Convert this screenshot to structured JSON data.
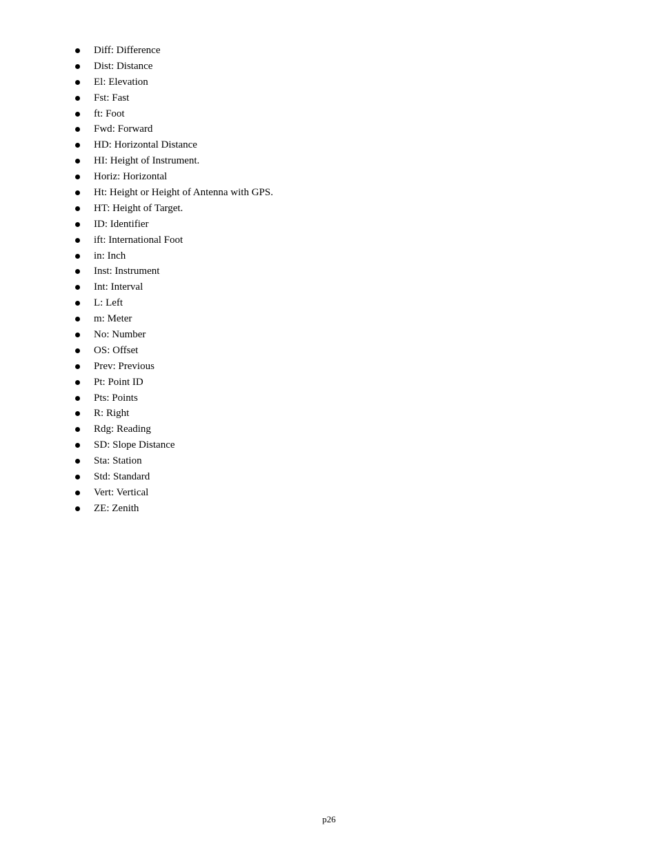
{
  "document": {
    "abbreviations": [
      {
        "abbr": "Diff",
        "meaning": "Difference"
      },
      {
        "abbr": "Dist",
        "meaning": "Distance"
      },
      {
        "abbr": "El",
        "meaning": "Elevation"
      },
      {
        "abbr": "Fst",
        "meaning": "Fast"
      },
      {
        "abbr": "ft",
        "meaning": "Foot"
      },
      {
        "abbr": "Fwd",
        "meaning": "Forward"
      },
      {
        "abbr": "HD",
        "meaning": "Horizontal Distance"
      },
      {
        "abbr": "HI",
        "meaning": "Height of Instrument."
      },
      {
        "abbr": "Horiz",
        "meaning": "Horizontal"
      },
      {
        "abbr": "Ht",
        "meaning": "Height or Height of Antenna with GPS."
      },
      {
        "abbr": "HT",
        "meaning": "Height of Target."
      },
      {
        "abbr": "ID",
        "meaning": "Identifier"
      },
      {
        "abbr": "ift",
        "meaning": "International Foot"
      },
      {
        "abbr": "in",
        "meaning": "Inch"
      },
      {
        "abbr": "Inst",
        "meaning": "Instrument"
      },
      {
        "abbr": "Int",
        "meaning": "Interval"
      },
      {
        "abbr": "L",
        "meaning": "Left"
      },
      {
        "abbr": "m",
        "meaning": "Meter"
      },
      {
        "abbr": "No",
        "meaning": "Number"
      },
      {
        "abbr": "OS",
        "meaning": "Offset"
      },
      {
        "abbr": "Prev",
        "meaning": "Previous"
      },
      {
        "abbr": "Pt",
        "meaning": "Point ID"
      },
      {
        "abbr": "Pts",
        "meaning": "Points"
      },
      {
        "abbr": "R",
        "meaning": "Right"
      },
      {
        "abbr": "Rdg",
        "meaning": "Reading"
      },
      {
        "abbr": "SD",
        "meaning": "Slope Distance"
      },
      {
        "abbr": "Sta",
        "meaning": "Station"
      },
      {
        "abbr": "Std",
        "meaning": "Standard"
      },
      {
        "abbr": "Vert",
        "meaning": "Vertical"
      },
      {
        "abbr": "ZE",
        "meaning": "Zenith"
      }
    ],
    "separator": ": ",
    "bullet_icon": "filled-circle-bullet",
    "page_number": "p26"
  }
}
